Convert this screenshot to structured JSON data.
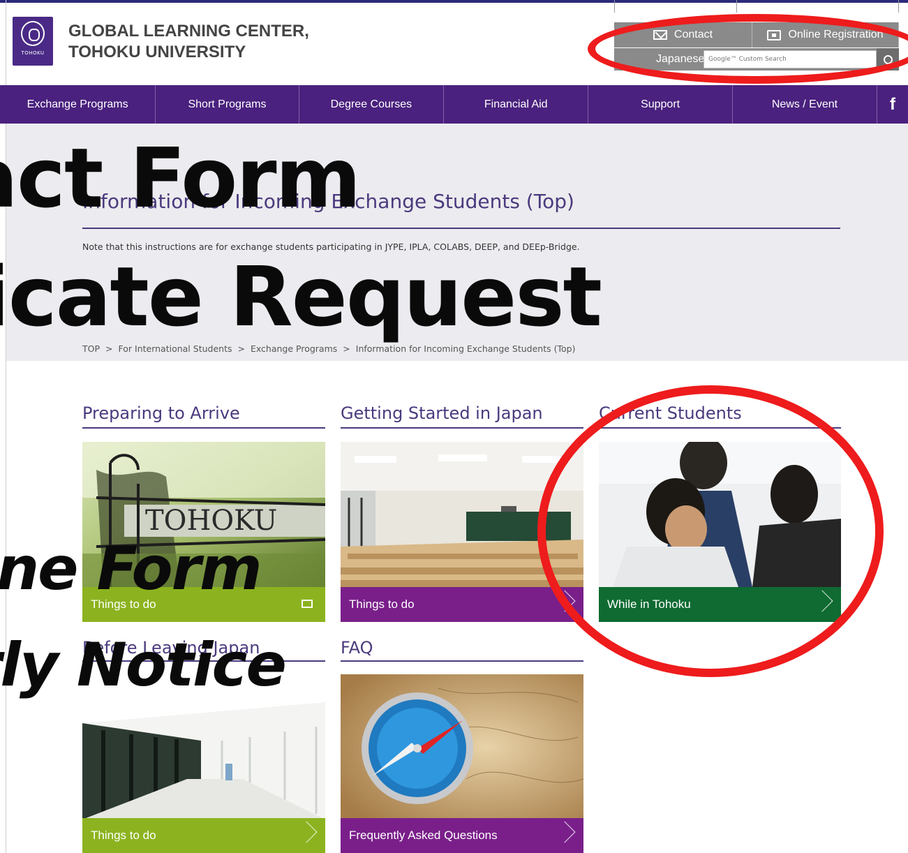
{
  "header": {
    "title_line1": "GLOBAL LEARNING CENTER,",
    "title_line2": "TOHOKU UNIVERSITY",
    "logo_text": "TOHOKU"
  },
  "utility": {
    "contact_label": "Contact",
    "registration_label": "Online Registration",
    "language_label": "Japanese",
    "search_placeholder": "Google™ Custom Search"
  },
  "nav": {
    "items": [
      {
        "label": "Exchange Programs"
      },
      {
        "label": "Short Programs"
      },
      {
        "label": "Degree Courses"
      },
      {
        "label": "Financial Aid"
      },
      {
        "label": "Support"
      },
      {
        "label": "News / Event"
      }
    ],
    "facebook_glyph": "f"
  },
  "page": {
    "title": "Information for Incoming Exchange Students (Top)",
    "note": "Note that this instructions are for exchange students participating in JYPE, IPLA, COLABS, DEEP, and DEEp-Bridge.",
    "breadcrumb": [
      "TOP",
      "For International Students",
      "Exchange Programs",
      "Information for Incoming Exchange Students (Top)"
    ],
    "breadcrumb_sep": ">"
  },
  "overlay": {
    "line1": "ntact Form",
    "line2": "rtificate Request",
    "line3": "line Form",
    "line4": "rly Notice"
  },
  "sections": [
    {
      "heading": "Preparing to Arrive",
      "link": "Things to do",
      "bar_color": "#8cb31f"
    },
    {
      "heading": "Getting Started in Japan",
      "link": "Things to do",
      "bar_color": "#7a1f8a"
    },
    {
      "heading": "Current Students",
      "link": "While in Tohoku",
      "bar_color": "#0f6b32"
    },
    {
      "heading": "Before Leaving Japan",
      "link": "Things to do",
      "bar_color": "#8cb31f"
    },
    {
      "heading": "FAQ",
      "link": "Frequently Asked Questions",
      "bar_color": "#7a1f8a"
    }
  ],
  "colors": {
    "nav_bg": "#4a217e",
    "accent": "#4b3a7e",
    "highlight_circle": "#ee1c1c"
  }
}
